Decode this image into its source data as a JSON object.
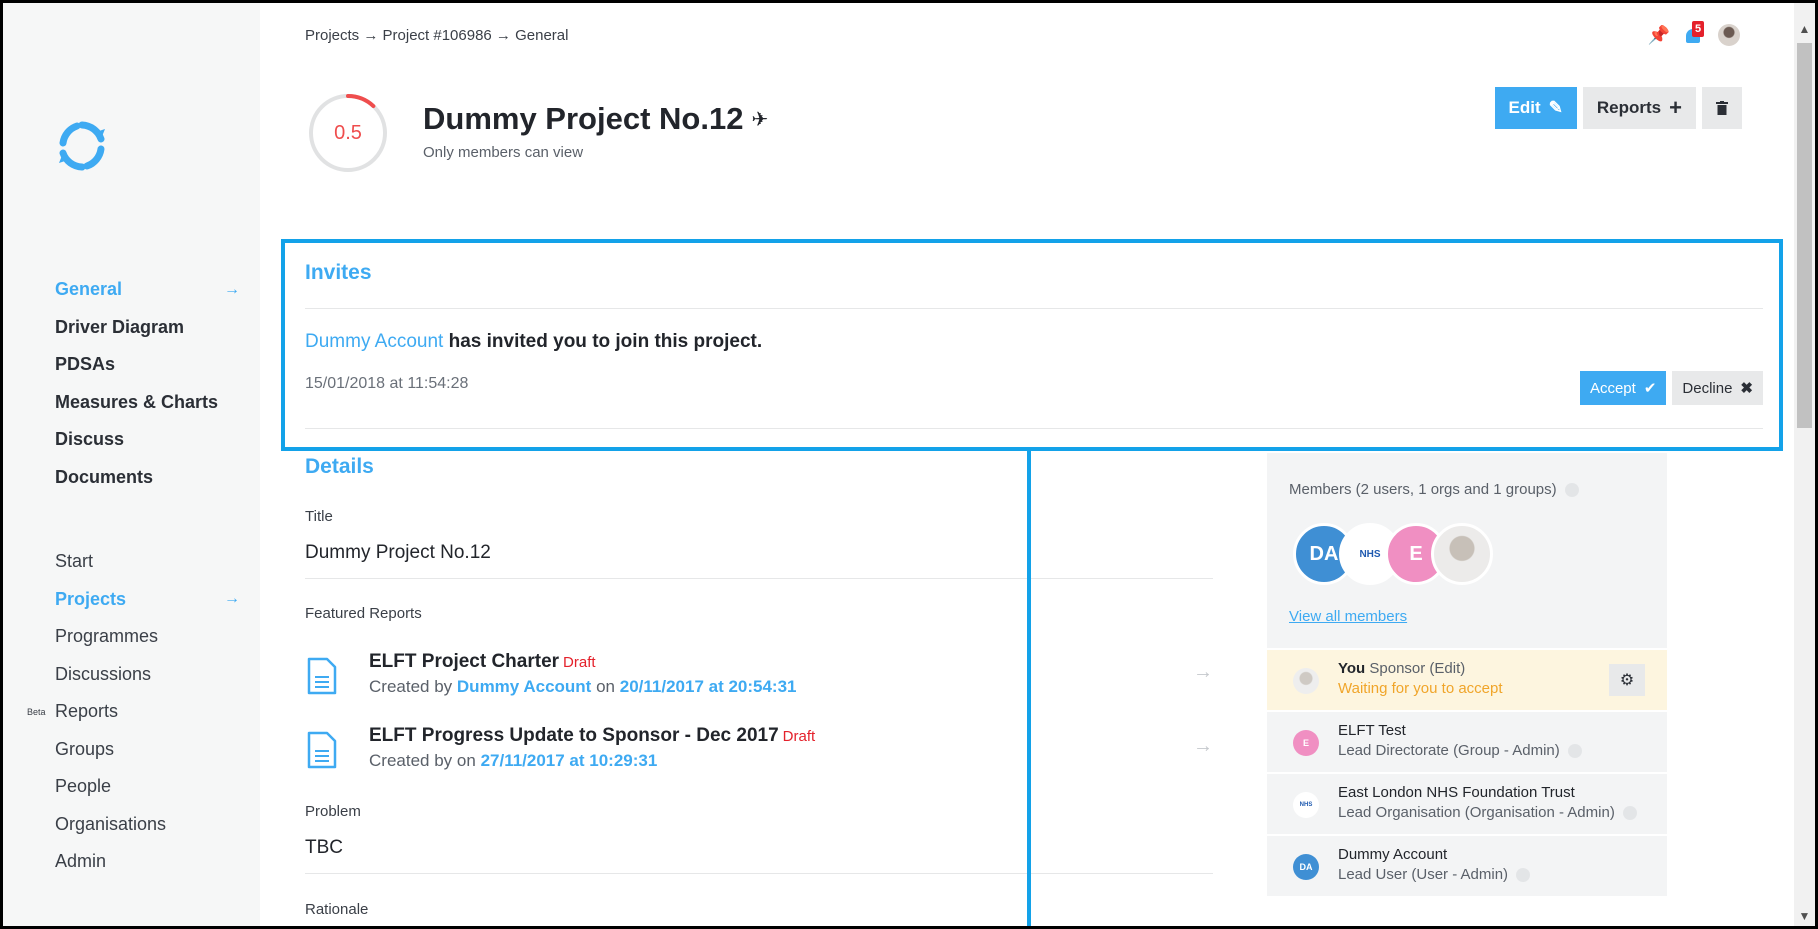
{
  "breadcrumb": "Projects → Project #106986 → General",
  "notifications": {
    "count": "5"
  },
  "project": {
    "score": "0.5",
    "score_fraction": 0.12,
    "title": "Dummy Project No.12",
    "visibility": "Only members can view"
  },
  "actions": {
    "edit": "Edit",
    "reports": "Reports"
  },
  "sidebar": {
    "top": [
      {
        "label": "General",
        "active": true
      },
      {
        "label": "Driver Diagram"
      },
      {
        "label": "PDSAs"
      },
      {
        "label": "Measures & Charts"
      },
      {
        "label": "Discuss"
      },
      {
        "label": "Documents"
      }
    ],
    "bottom": [
      {
        "label": "Start"
      },
      {
        "label": "Projects",
        "active": true
      },
      {
        "label": "Programmes"
      },
      {
        "label": "Discussions"
      },
      {
        "label": "Reports",
        "beta": "Beta"
      },
      {
        "label": "Groups"
      },
      {
        "label": "People"
      },
      {
        "label": "Organisations"
      },
      {
        "label": "Admin"
      }
    ]
  },
  "invites": {
    "title": "Invites",
    "inviter": "Dummy Account",
    "message": " has invited you to join this project.",
    "date": "15/01/2018 at 11:54:28",
    "accept": "Accept",
    "decline": "Decline"
  },
  "details": {
    "title": "Details",
    "title_label": "Title",
    "title_value": "Dummy Project No.12",
    "featured_label": "Featured Reports",
    "reports": [
      {
        "title": "ELFT Project Charter",
        "status": "Draft",
        "created_by_prefix": "Created by",
        "author": "Dummy Account",
        "on": "on",
        "date": "20/11/2017 at 20:54:31"
      },
      {
        "title": "ELFT Progress Update to Sponsor - Dec 2017",
        "status": "Draft",
        "created_by_prefix": "Created by",
        "author": "",
        "on": "on",
        "date": "27/11/2017 at 10:29:31"
      }
    ],
    "problem_label": "Problem",
    "problem_value": "TBC",
    "rationale_label": "Rationale"
  },
  "members": {
    "header": "Members (2 users, 1 orgs and 1 groups)",
    "avatars": [
      "DA",
      "NHS",
      "E",
      ""
    ],
    "nhs_logo_text": "NHS",
    "view_all": "View all members",
    "rows": [
      {
        "name": "You",
        "role": "Sponsor (Edit)",
        "sub": "Waiting for you to accept",
        "avatar": ""
      },
      {
        "name": "ELFT Test",
        "role": "",
        "sub": "Lead Directorate (Group - Admin)",
        "avatar": "E"
      },
      {
        "name": "East London NHS Foundation Trust",
        "role": "",
        "sub": "Lead Organisation (Organisation - Admin)",
        "avatar": "NHS"
      },
      {
        "name": "Dummy Account",
        "role": "",
        "sub": "Lead User (User - Admin)",
        "avatar": "DA"
      }
    ]
  },
  "colors": {
    "accent": "#3eaaf2",
    "highlight": "#13a2e9",
    "danger": "#e4212b",
    "warning": "#f0a52a"
  }
}
